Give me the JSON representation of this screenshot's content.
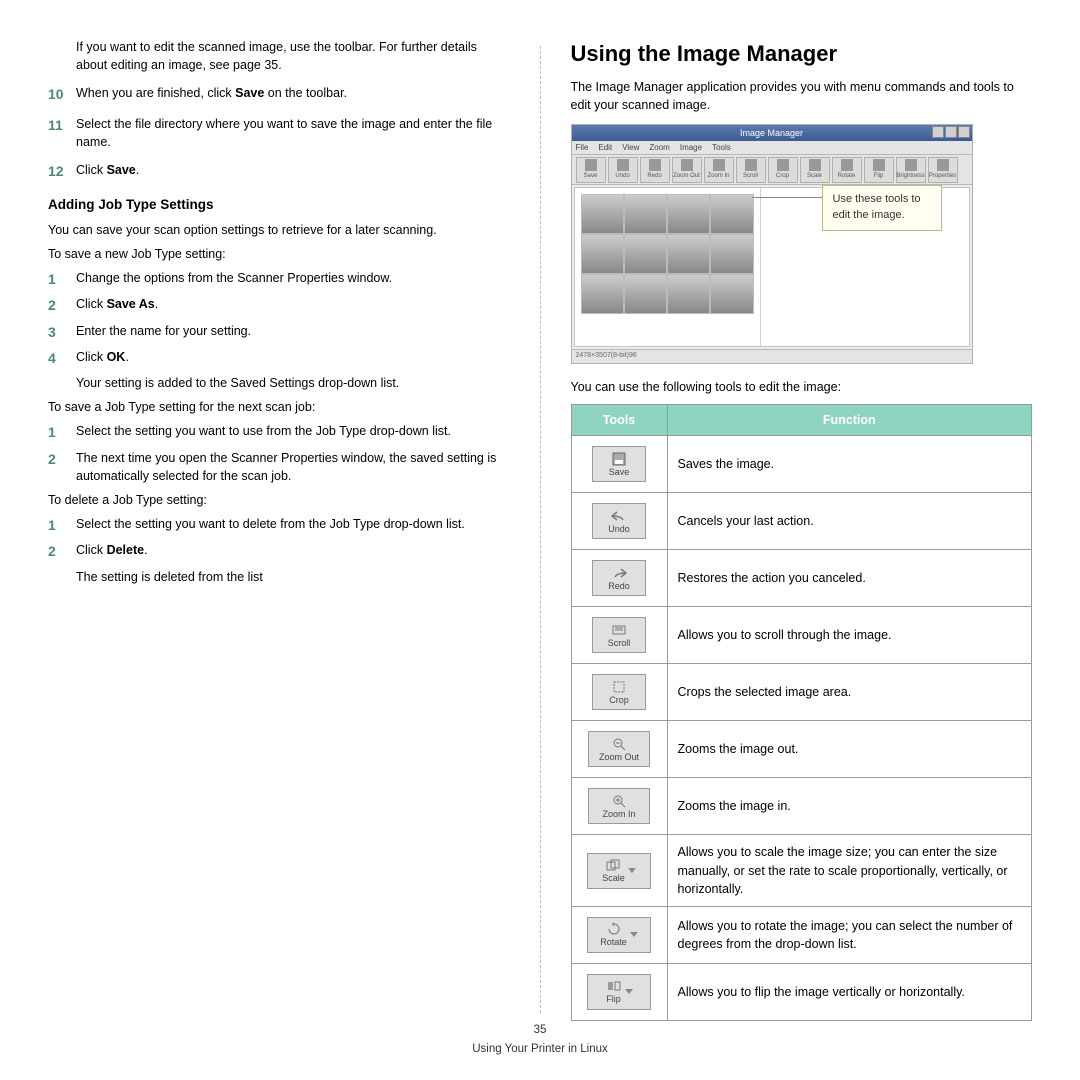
{
  "left": {
    "intro": "If you want to edit the scanned image, use the toolbar. For further details about editing an image, see page 35.",
    "steps_a": [
      {
        "n": "10",
        "before": "When you are finished, click ",
        "bold": "Save",
        "after": " on the toolbar."
      },
      {
        "n": "11",
        "before": "Select the file directory where you want to save the image and enter the file name.",
        "bold": "",
        "after": ""
      },
      {
        "n": "12",
        "before": "Click ",
        "bold": "Save",
        "after": "."
      }
    ],
    "h4": "Adding Job Type Settings",
    "p1": "You can save your scan option settings to retrieve for a later scanning.",
    "p2": "To save a new Job Type setting:",
    "steps_b": [
      {
        "n": "1",
        "before": "Change the options from the Scanner Properties window.",
        "bold": "",
        "after": ""
      },
      {
        "n": "2",
        "before": "Click ",
        "bold": "Save As",
        "after": "."
      },
      {
        "n": "3",
        "before": "Enter the name for your setting.",
        "bold": "",
        "after": ""
      },
      {
        "n": "4",
        "before": "Click ",
        "bold": "OK",
        "after": "."
      }
    ],
    "sub_b": "Your setting is added to the Saved Settings drop-down list.",
    "p3": "To save a Job Type setting for the next scan job:",
    "steps_c": [
      {
        "n": "1",
        "before": "Select the setting you want to use from the Job Type drop-down list.",
        "bold": "",
        "after": ""
      },
      {
        "n": "2",
        "before": "The next time you open the Scanner Properties window, the saved setting is automatically selected for the scan job.",
        "bold": "",
        "after": ""
      }
    ],
    "p4": "To delete a Job Type setting:",
    "steps_d": [
      {
        "n": "1",
        "before": "Select the setting you want to delete from the Job Type drop-down list.",
        "bold": "",
        "after": ""
      },
      {
        "n": "2",
        "before": "Click ",
        "bold": "Delete",
        "after": "."
      }
    ],
    "sub_d": "The setting is deleted from the list"
  },
  "right": {
    "h2": "Using the Image Manager",
    "intro": "The Image Manager application provides you with menu commands and tools to edit your scanned image.",
    "ss": {
      "title": "Image Manager",
      "menus": [
        "File",
        "Edit",
        "View",
        "Zoom",
        "Image",
        "Tools"
      ],
      "tb": [
        "Save",
        "Undo",
        "Redo",
        "Zoom Out",
        "Zoom In",
        "Scroll",
        "Crop",
        "Scale",
        "Rotate",
        "Flip",
        "Brightness",
        "Properties"
      ],
      "callout": "Use these tools to edit the image.",
      "status": "2478×3507(8-bit)96"
    },
    "table_intro": "You can use the following tools to edit the image:",
    "th_tools": "Tools",
    "th_func": "Function",
    "rows": [
      {
        "label": "Save",
        "func": "Saves the image."
      },
      {
        "label": "Undo",
        "func": "Cancels your last action."
      },
      {
        "label": "Redo",
        "func": "Restores the action you canceled."
      },
      {
        "label": "Scroll",
        "func": "Allows you to scroll through the image."
      },
      {
        "label": "Crop",
        "func": "Crops the selected image area."
      },
      {
        "label": "Zoom Out",
        "func": "Zooms the image out."
      },
      {
        "label": "Zoom In",
        "func": "Zooms the image in."
      },
      {
        "label": "Scale",
        "func": "Allows you to scale the image size; you can enter the size manually, or set the rate to scale proportionally, vertically, or horizontally."
      },
      {
        "label": "Rotate",
        "func": "Allows you to rotate the image; you can select the number of degrees from the drop-down list."
      },
      {
        "label": "Flip",
        "func": "Allows you to flip the image vertically or horizontally."
      }
    ]
  },
  "footer": {
    "page": "35",
    "title": "Using Your Printer in Linux"
  }
}
